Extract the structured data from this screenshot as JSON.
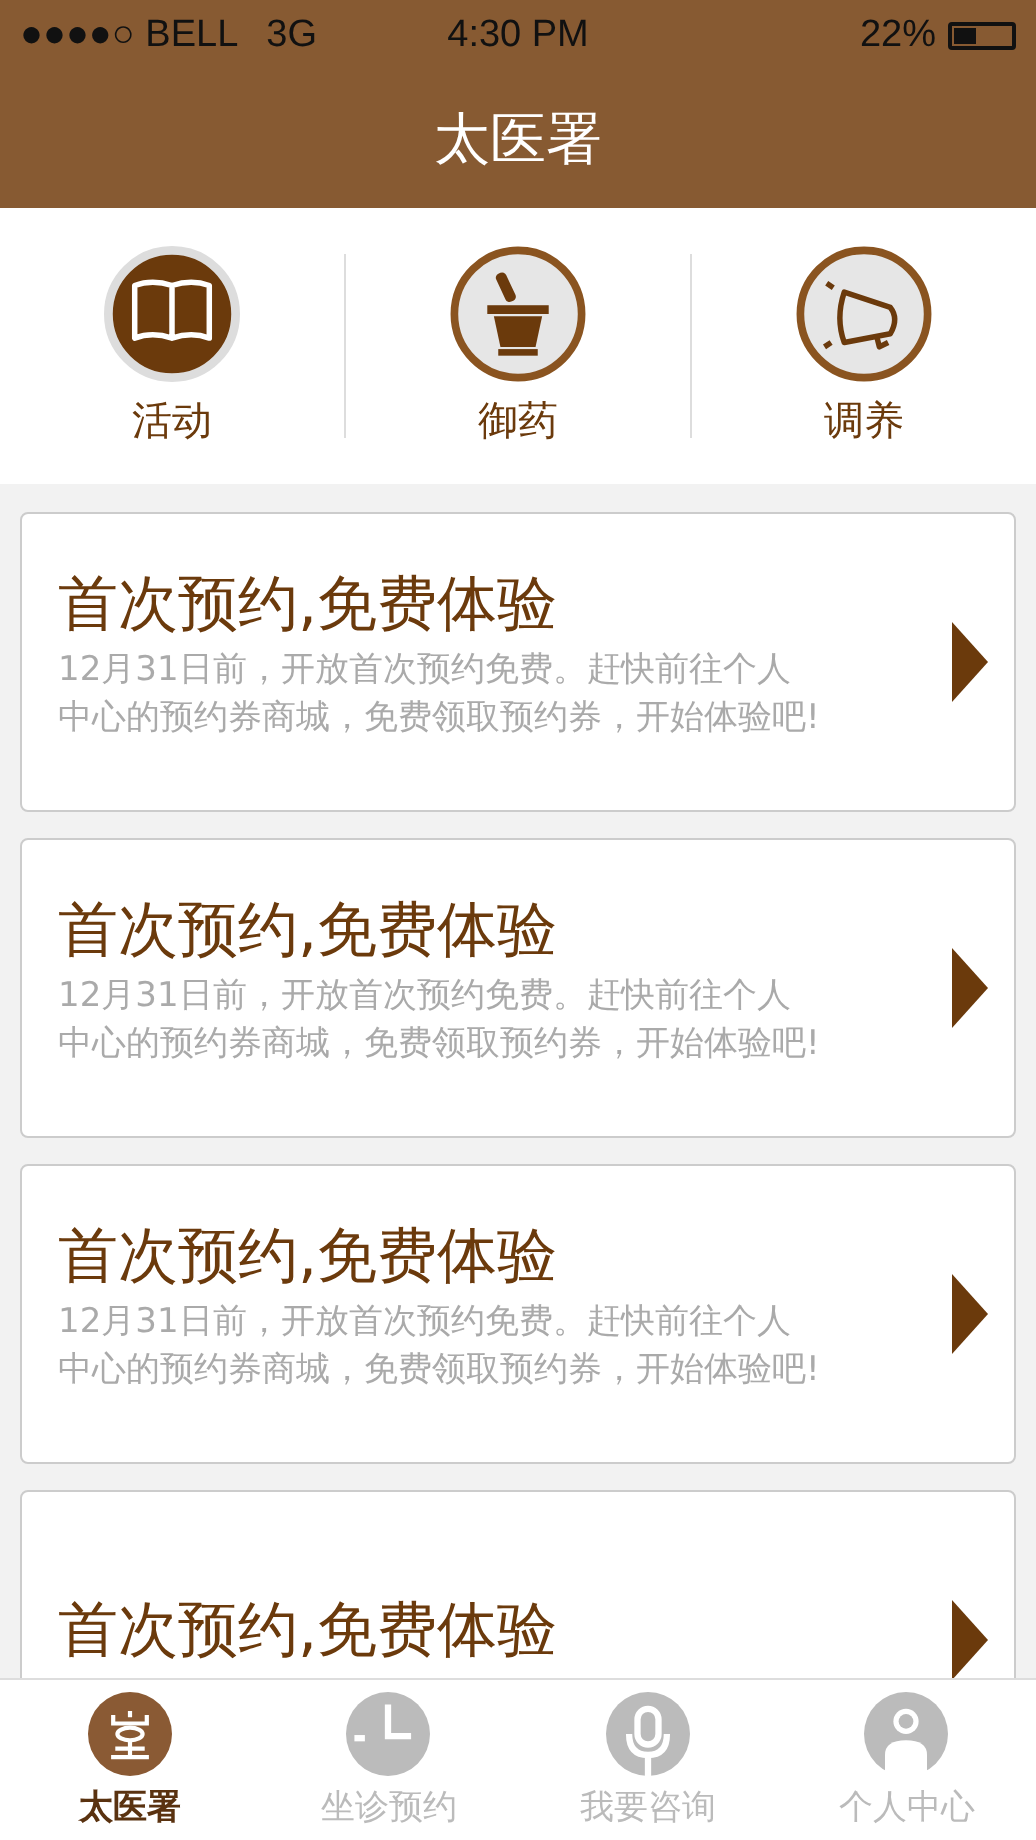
{
  "status_bar": {
    "carrier": "●●●●○ BELL",
    "network": "3G",
    "time": "4:30 PM",
    "battery": "22%"
  },
  "header": {
    "title": "太医署"
  },
  "categories": [
    {
      "label": "活动",
      "kind": "book",
      "selected": true
    },
    {
      "label": "御药",
      "kind": "mortar",
      "selected": false
    },
    {
      "label": "调养",
      "kind": "megaphone",
      "selected": false
    }
  ],
  "cards": [
    {
      "title": "首次预约,免费体验",
      "body_lines": [
        "12月31日前，开放首次预约免费。赶快前往个人",
        "中心的预约券商城，免费领取预约券，开始体验吧!"
      ]
    },
    {
      "title": "首次预约,免费体验",
      "body_lines": [
        "12月31日前，开放首次预约免费。赶快前往个人",
        "中心的预约券商城，免费领取预约券，开始体验吧!"
      ]
    },
    {
      "title": "首次预约,免费体验",
      "body_lines": [
        "12月31日前，开放首次预约免费。赶快前往个人",
        "中心的预约券商城，免费领取预约券，开始体验吧!"
      ]
    },
    {
      "title": "首次预约,免费体验"
    }
  ],
  "tab_bar": [
    {
      "label": "太医署",
      "kind": "hall",
      "selected": true
    },
    {
      "label": "坐诊预约",
      "kind": "clock",
      "selected": false
    },
    {
      "label": "我要咨询",
      "kind": "mic",
      "selected": false
    },
    {
      "label": "个人中心",
      "kind": "person",
      "selected": false
    }
  ]
}
